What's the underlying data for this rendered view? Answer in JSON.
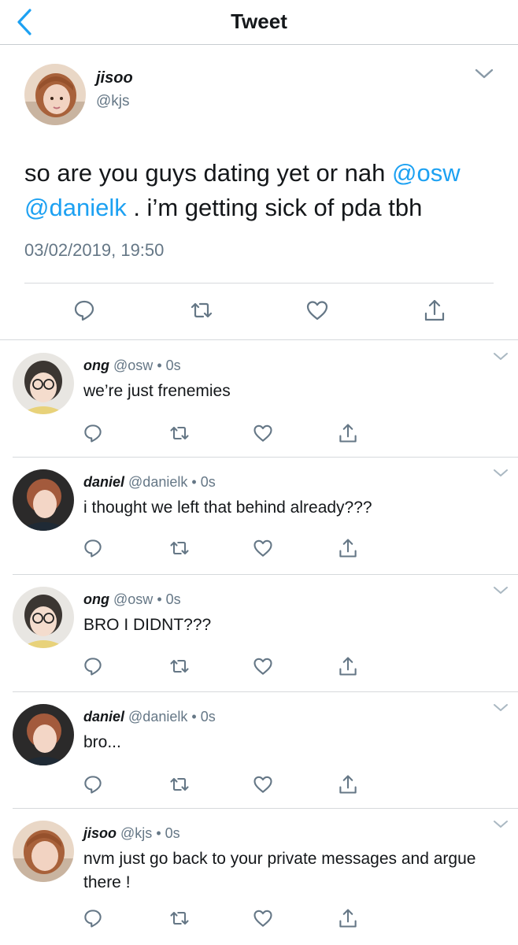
{
  "header": {
    "title": "Tweet",
    "back_icon": "chevron-left-icon",
    "accent": "#1da1f2"
  },
  "tweet": {
    "name": "jisoo",
    "handle": "@kjs",
    "text_before": "so are you guys dating yet or nah ",
    "mention1": "@osw",
    "mention2": "@danielk",
    "text_after": " . i’m getting sick of pda tbh",
    "timestamp": "03/02/2019, 19:50"
  },
  "replies": [
    {
      "name": "ong",
      "handle": "@osw",
      "dot": "•",
      "time": "0s",
      "text": "we’re just frenemies"
    },
    {
      "name": "daniel",
      "handle": "@danielk",
      "dot": "•",
      "time": "0s",
      "text": "i thought we left that behind already???"
    },
    {
      "name": "ong",
      "handle": "@osw",
      "dot": "•",
      "time": "0s",
      "text": "BRO I DIDNT???"
    },
    {
      "name": "daniel",
      "handle": "@danielk",
      "dot": "•",
      "time": "0s",
      "text": "bro..."
    },
    {
      "name": "jisoo",
      "handle": "@kjs",
      "dot": "•",
      "time": "0s",
      "text": "nvm just go back to your private messages and argue there !"
    }
  ],
  "icons": [
    "reply-icon",
    "retweet-icon",
    "like-icon",
    "share-icon",
    "chevron-down-icon"
  ],
  "colors": {
    "text": "#14171a",
    "secondary": "#657786",
    "mention": "#1da1f2",
    "divider": "#d6d9dc"
  }
}
